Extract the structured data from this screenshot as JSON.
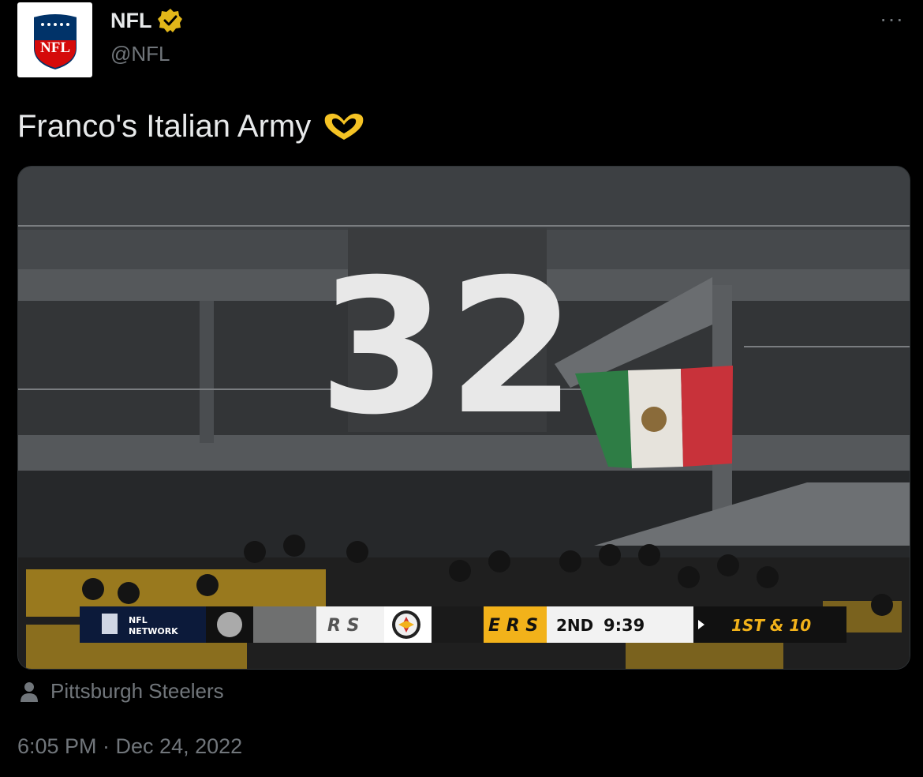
{
  "tweet": {
    "author_name": "NFL",
    "handle": "@NFL",
    "text": "Franco's Italian Army",
    "more_label": "···",
    "tagged_account": "Pittsburgh Steelers",
    "timestamp": "6:05 PM · Dec 24, 2022",
    "verified_color": "#e2b719"
  },
  "avatar": {
    "logo_text": "NFL"
  },
  "media": {
    "banner_number": "32",
    "scorebug": {
      "network_line1": "NFL",
      "network_line2": "NETWORK",
      "away_abbrev": "R S",
      "home_abbrev": "E R S",
      "quarter": "2ND",
      "clock": "9:39",
      "down_distance": "1ST & 10"
    }
  },
  "colors": {
    "background": "#000000",
    "text_primary": "#e7e9ea",
    "text_secondary": "#71767b",
    "steelers_gold": "#f2b21a",
    "flag_green": "#2e7d45",
    "flag_red": "#c8323a"
  }
}
